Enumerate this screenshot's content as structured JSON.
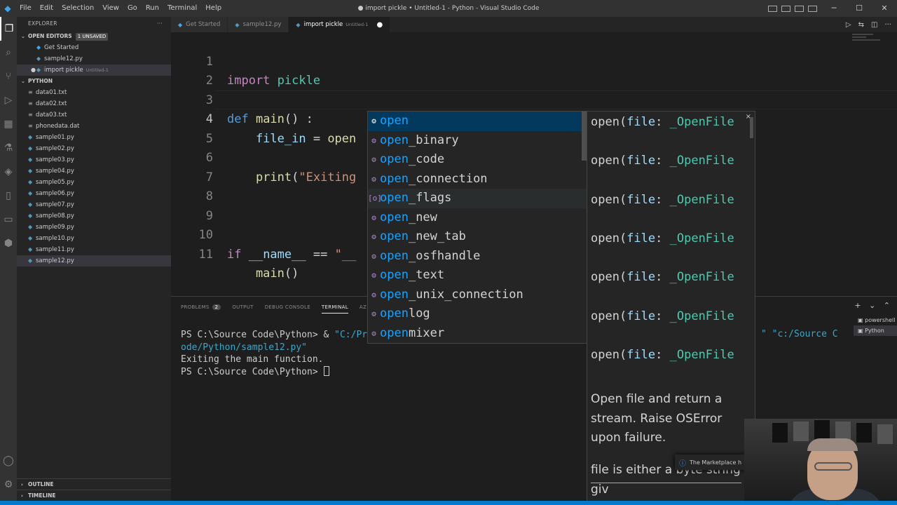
{
  "titlebar": {
    "menu": [
      "File",
      "Edit",
      "Selection",
      "View",
      "Go",
      "Run",
      "Terminal",
      "Help"
    ],
    "window_title": "● import pickle • Untitled-1 - Python - Visual Studio Code"
  },
  "sidebar": {
    "header": "EXPLORER",
    "open_editors": {
      "title": "OPEN EDITORS",
      "badge": "1 UNSAVED",
      "items": [
        {
          "label": "Get Started",
          "icon": "vscode-icon",
          "meta": ""
        },
        {
          "label": "sample12.py",
          "icon": "python-file-icon",
          "meta": ""
        },
        {
          "label": "import pickle",
          "icon": "python-file-icon",
          "meta": "Untitled-1"
        }
      ]
    },
    "folder": {
      "title": "PYTHON",
      "files": [
        "data01.txt",
        "data02.txt",
        "data03.txt",
        "phonedata.dat",
        "sample01.py",
        "sample02.py",
        "sample03.py",
        "sample04.py",
        "sample05.py",
        "sample06.py",
        "sample07.py",
        "sample08.py",
        "sample09.py",
        "sample10.py",
        "sample11.py",
        "sample12.py"
      ]
    },
    "outline": "OUTLINE",
    "timeline": "TIMELINE"
  },
  "tabs": [
    {
      "label": "Get Started",
      "meta": ""
    },
    {
      "label": "sample12.py",
      "meta": ""
    },
    {
      "label": "import pickle",
      "meta": "Untitled-1"
    }
  ],
  "editor": {
    "line_numbers": [
      "1",
      "2",
      "3",
      "4",
      "5",
      "6",
      "7",
      "8",
      "9",
      "10",
      "11"
    ],
    "code": {
      "l1_kw": "import",
      "l1_mod": " pickle",
      "l3_kw": "def",
      "l3_fn": " main",
      "l3_rest": "() :",
      "l4_var": "    file_in",
      "l4_op": " = ",
      "l4_fn": "open",
      "l6_fn": "    print",
      "l6_paren": "(",
      "l6_str": "\"Exiting",
      "l10_kw": "if",
      "l10_var": " __name__",
      "l10_op": " == ",
      "l10_str": "\"__",
      "l11_fn": "    main",
      "l11_rest": "()"
    }
  },
  "suggest": {
    "prefix": "open",
    "items": [
      {
        "rest": "",
        "icon": "⚙"
      },
      {
        "rest": "_binary",
        "icon": "⚙"
      },
      {
        "rest": "_code",
        "icon": "⚙"
      },
      {
        "rest": "_connection",
        "icon": "⚙"
      },
      {
        "rest": "_flags",
        "icon": "[o]"
      },
      {
        "rest": "_new",
        "icon": "⚙"
      },
      {
        "rest": "_new_tab",
        "icon": "⚙"
      },
      {
        "rest": "_osfhandle",
        "icon": "⚙"
      },
      {
        "rest": "_text",
        "icon": "⚙"
      },
      {
        "rest": "_unix_connection",
        "icon": "⚙"
      },
      {
        "rest": "log",
        "icon": "⚙"
      },
      {
        "rest": "mixer",
        "icon": "⚙"
      }
    ]
  },
  "details": {
    "sig_fn": "open(",
    "sig_param": "file",
    "sig_colon": ": ",
    "sig_type": "_OpenFile",
    "doc1": "Open file and return a stream. Raise OSError upon failure.",
    "doc2": "file is either a byte string giv"
  },
  "panel": {
    "tabs": [
      "PROBLEMS",
      "OUTPUT",
      "DEBUG CONSOLE",
      "TERMINAL",
      "AZ"
    ],
    "problems_count": "2",
    "terminal_lines": {
      "l1_prompt": "PS C:\\Source Code\\Python> & ",
      "l1_str": "\"C:/Pr",
      "l2": "ode/Python/sample12.py\"",
      "l3": "Exiting the main function.",
      "l4": "PS C:\\Source Code\\Python> "
    },
    "terminal_right": "\" \"c:/Source C",
    "terminals": [
      "powershell",
      "Python"
    ]
  },
  "notification": {
    "text": "The Marketplace h"
  }
}
